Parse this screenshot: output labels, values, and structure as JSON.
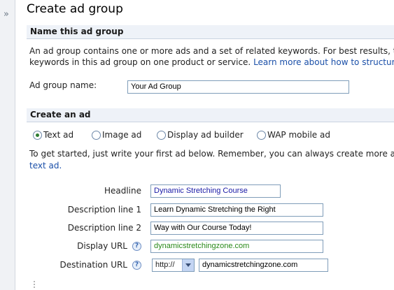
{
  "page_title": "Create ad group",
  "section_name": {
    "heading": "Name this ad group",
    "intro_line1": "An ad group contains one or more ads and a set of related keywords. For best results, try",
    "intro_line2_prefix": "keywords in this ad group on one product or service.",
    "learn_more_link": "Learn more about how to structure yo",
    "group_name_label": "Ad group name:",
    "group_name_value": "Your Ad Group"
  },
  "section_ad": {
    "heading": "Create an ad",
    "ad_types": [
      {
        "label": "Text ad",
        "selected": true
      },
      {
        "label": "Image ad",
        "selected": false
      },
      {
        "label": "Display ad builder",
        "selected": false
      },
      {
        "label": "WAP mobile ad",
        "selected": false
      }
    ],
    "instructions_line1": "To get started, just write your first ad below. Remember, you can always create more ads",
    "instructions_link": "text ad."
  },
  "form": {
    "headline_label": "Headline",
    "headline_value": "Dynamic Stretching Course",
    "desc1_label": "Description line 1",
    "desc1_value": "Learn Dynamic Stretching the Right",
    "desc2_label": "Description line 2",
    "desc2_value": "Way with Our Course Today!",
    "display_url_label": "Display URL",
    "display_url_value": "dynamicstretchingzone.com",
    "dest_url_label": "Destination URL",
    "dest_protocol": "http://",
    "dest_url_value": "dynamicstretchingzone.com",
    "help_glyph": "?"
  },
  "sidebar": {
    "expand_glyph": "»"
  },
  "colors": {
    "headline_text": "#1a1aa6",
    "display_url_text": "#2a8a1a",
    "link": "#1a4fa8",
    "radio_selected": "#2e7d32"
  }
}
